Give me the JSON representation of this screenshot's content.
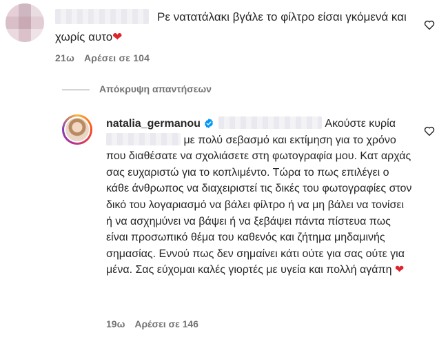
{
  "comment1": {
    "text": "Ρε νατατάλακι βγάλε το φίλτρο είσαι γκόμενά και χωρίς αυτο",
    "heart": "❤",
    "time": "21ω",
    "likes": "Αρέσει σε 104",
    "avatar": "blurred-avatar",
    "username": "blurred"
  },
  "replies_toggle": "Απόκρυψη απαντήσεων",
  "comment2": {
    "username": "natalia_germanou",
    "verified": "verified-badge-icon",
    "text_part1": "Ακούστε",
    "text_part2": "κυρία",
    "text_part3": "με πολύ σεβασμό και εκτίμηση για το χρόνο που διαθέσατε να σχολιάσετε στη φωτογραφία μου. Κατ αρχάς σας ευχαριστώ για το κοπλιμέντο. Τώρα το πως επιλέγει ο κάθε άνθρωπος να διαχειριστεί τις δικές του φωτογραφίες στον δικό του λογαριασμό να βάλει φίλτρο ή να μη βάλει να τονίσει ή να ασχημύνει να βάψει ή να ξεβάψει πάντα πίστευα πως είναι προσωπικό θέμα του καθενός και ζήτημα μηδαμινής σημασίας. Εννού πως δεν σημαίνει κάτι ούτε για σας ούτε για μένα. Σας εύχομαι καλές γιορτές με υγεία και πολλή αγάπη",
    "heart": "❤",
    "time": "19ω",
    "likes": "Αρέσει σε 146"
  },
  "colors": {
    "text": "#262626",
    "meta": "#737373",
    "heart": "#e0242f",
    "verified": "#0095f6"
  }
}
